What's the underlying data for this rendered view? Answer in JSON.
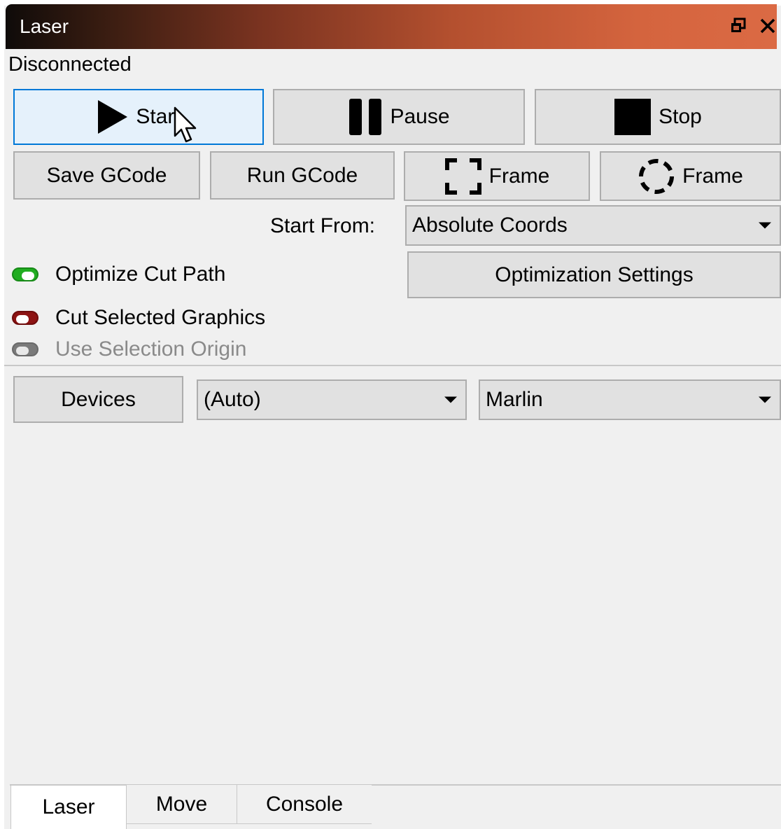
{
  "window": {
    "title": "Laser",
    "restore_icon": "restore-window-icon",
    "close_icon": "close-icon"
  },
  "status": "Disconnected",
  "job_buttons": {
    "start": {
      "label": "Start",
      "icon": "play-icon"
    },
    "pause": {
      "label": "Pause",
      "icon": "pause-icon"
    },
    "stop": {
      "label": "Stop",
      "icon": "stop-icon"
    }
  },
  "gcode_buttons": {
    "save": "Save GCode",
    "run": "Run GCode",
    "frame_rect": {
      "label": "Frame",
      "icon": "frame-rectangle-icon"
    },
    "frame_round": {
      "label": "Frame",
      "icon": "frame-circle-icon"
    }
  },
  "start_from": {
    "label": "Start From:",
    "value": "Absolute Coords"
  },
  "options": {
    "optimize_cut_path": {
      "label": "Optimize Cut Path",
      "state": "on",
      "color": "#21ad21"
    },
    "optimization_settings": "Optimization Settings",
    "cut_selected_graphics": {
      "label": "Cut Selected Graphics",
      "state": "off",
      "color": "#8d1313"
    },
    "use_selection_origin": {
      "label": "Use Selection Origin",
      "state": "disabled",
      "color": "#7a7a7a"
    }
  },
  "devices": {
    "button": "Devices",
    "port": "(Auto)",
    "firmware": "Marlin"
  },
  "tabs": [
    {
      "label": "Laser",
      "active": true
    },
    {
      "label": "Move",
      "active": false
    },
    {
      "label": "Console",
      "active": false
    }
  ],
  "colors": {
    "accent_border": "#0078d7",
    "title_gradient_start": "#0f0b09",
    "title_gradient_end": "#db6a44"
  }
}
